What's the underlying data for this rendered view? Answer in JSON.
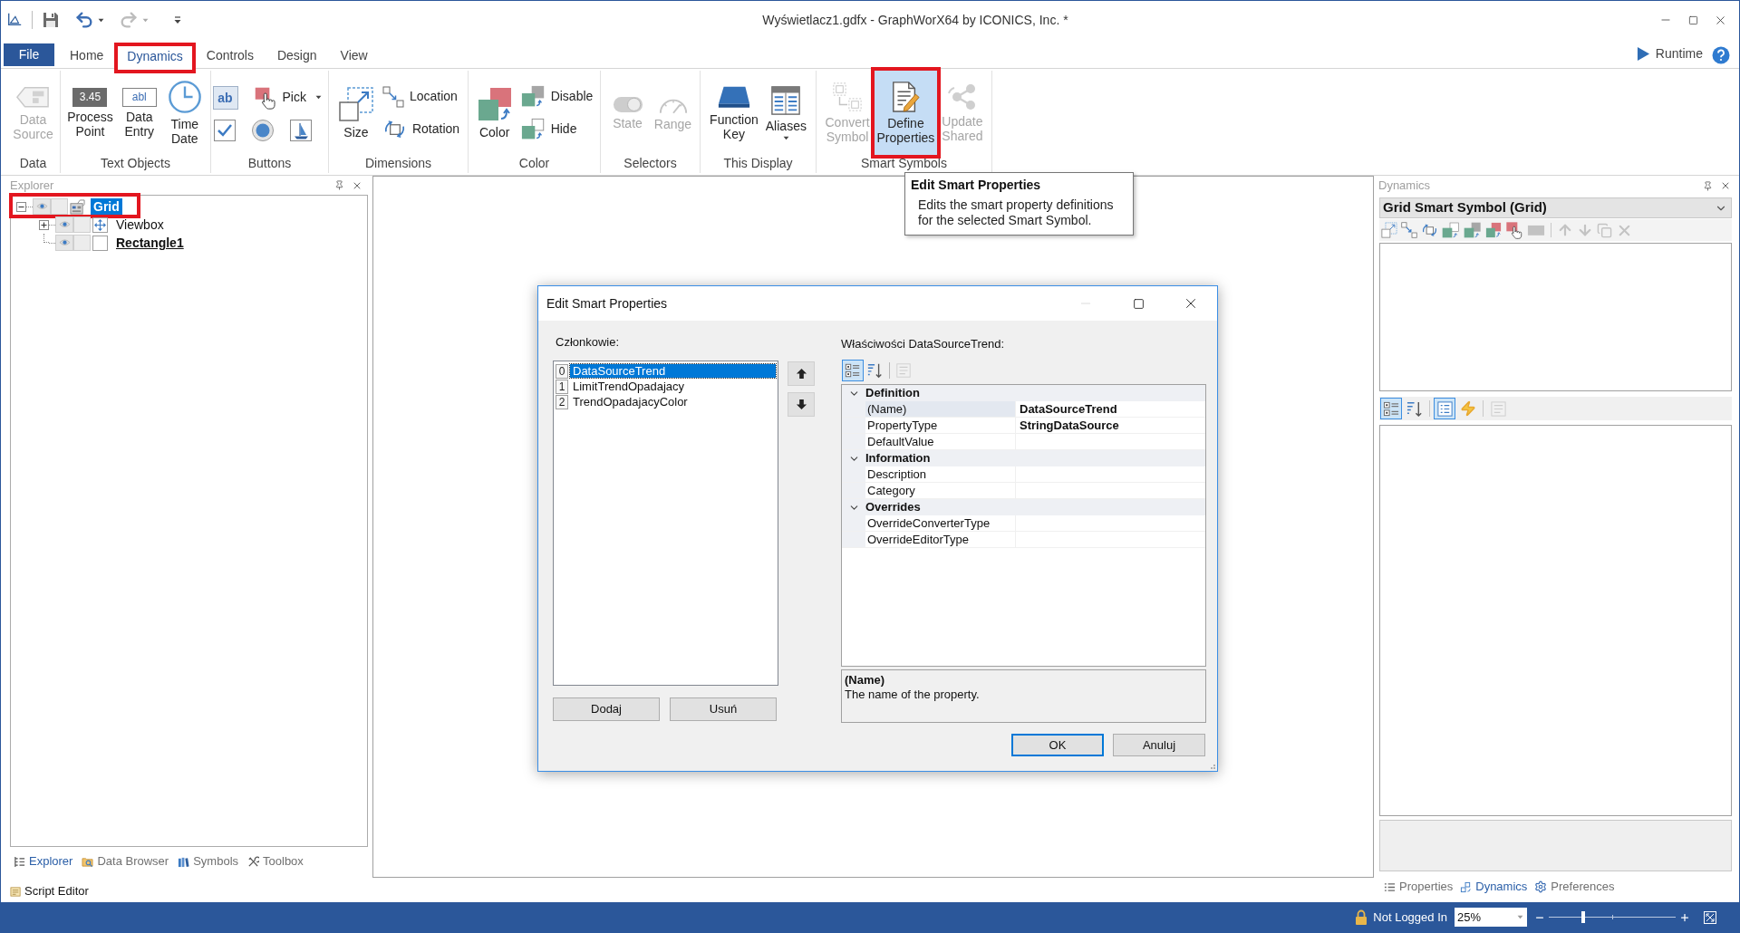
{
  "title_bar": {
    "quick_access": [
      {
        "disabled": false
      },
      {
        "disabled": false
      },
      {
        "disabled": true
      }
    ],
    "title": "Wyświetlacz1.gdfx - GraphWorX64 by ICONICS, Inc. *"
  },
  "ribbon": {
    "file_label": "File",
    "tabs": [
      {
        "label": "Home",
        "selected": false,
        "outlined": false
      },
      {
        "label": "Dynamics",
        "selected": true,
        "outlined": true
      },
      {
        "label": "Controls",
        "selected": false,
        "outlined": false
      },
      {
        "label": "Design",
        "selected": false,
        "outlined": false
      },
      {
        "label": "View",
        "selected": false,
        "outlined": false
      }
    ],
    "runtime_label": "Runtime",
    "groups": [
      {
        "label": "Data",
        "items": [
          {
            "kind": "large",
            "label": "Data Source",
            "disabled": true,
            "highlighted": false,
            "outlined": false,
            "dropdown": false
          }
        ]
      },
      {
        "label": "Text Objects",
        "items": [
          {
            "kind": "large",
            "label": "Process Point",
            "icon_text": "3.45",
            "disabled": false,
            "highlighted": false,
            "outlined": false,
            "dropdown": false
          },
          {
            "kind": "large",
            "label": "Data Entry",
            "icon_text": "abl",
            "disabled": false,
            "highlighted": false,
            "outlined": false,
            "dropdown": false
          },
          {
            "kind": "large",
            "label": "Time Date",
            "disabled": false,
            "highlighted": false,
            "outlined": false,
            "dropdown": false
          }
        ]
      },
      {
        "label": "Buttons",
        "items": [
          {
            "kind": "icon",
            "icon_text": "ab",
            "disabled": false,
            "highlighted": false,
            "outlined": false
          },
          {
            "kind": "small",
            "label": "Pick",
            "disabled": false,
            "highlighted": false,
            "outlined": false,
            "dropdown": true
          },
          {
            "kind": "icon",
            "disabled": false,
            "highlighted": false,
            "outlined": false
          },
          {
            "kind": "icon",
            "disabled": false,
            "highlighted": false,
            "outlined": false
          },
          {
            "kind": "icon",
            "disabled": false,
            "highlighted": false,
            "outlined": false
          }
        ]
      },
      {
        "label": "Dimensions",
        "items": [
          {
            "kind": "large",
            "label": "Size",
            "disabled": false,
            "highlighted": false,
            "outlined": false,
            "dropdown": false
          },
          {
            "kind": "small",
            "label": "Location",
            "disabled": false,
            "highlighted": false,
            "outlined": false,
            "dropdown": false
          },
          {
            "kind": "small",
            "label": "Rotation",
            "disabled": false,
            "highlighted": false,
            "outlined": false,
            "dropdown": false
          }
        ]
      },
      {
        "label": "Color",
        "items": [
          {
            "kind": "large",
            "label": "Color",
            "disabled": false,
            "highlighted": false,
            "outlined": false,
            "dropdown": false
          },
          {
            "kind": "small",
            "label": "Disable",
            "disabled": false,
            "highlighted": false,
            "outlined": false,
            "dropdown": false
          },
          {
            "kind": "small",
            "label": "Hide",
            "disabled": false,
            "highlighted": false,
            "outlined": false,
            "dropdown": false
          }
        ]
      },
      {
        "label": "Selectors",
        "items": [
          {
            "kind": "large",
            "label": "State",
            "disabled": true,
            "highlighted": false,
            "outlined": false,
            "dropdown": false
          },
          {
            "kind": "large",
            "label": "Range",
            "disabled": true,
            "highlighted": false,
            "outlined": false,
            "dropdown": false
          }
        ]
      },
      {
        "label": "This Display",
        "items": [
          {
            "kind": "large",
            "label": "Function Key",
            "disabled": false,
            "highlighted": false,
            "outlined": false,
            "dropdown": false
          },
          {
            "kind": "large",
            "label": "Aliases",
            "disabled": false,
            "highlighted": false,
            "outlined": false,
            "dropdown": true
          }
        ]
      },
      {
        "label": "Smart Symbols",
        "items": [
          {
            "kind": "large",
            "label": "Convert Symbol",
            "disabled": true,
            "highlighted": false,
            "outlined": false,
            "dropdown": false
          },
          {
            "kind": "large",
            "label": "Define Properties",
            "disabled": false,
            "highlighted": true,
            "outlined": true,
            "dropdown": false
          },
          {
            "kind": "large",
            "label": "Update Shared",
            "disabled": true,
            "highlighted": false,
            "outlined": false,
            "dropdown": false
          }
        ]
      }
    ]
  },
  "tooltip": {
    "title": "Edit Smart Properties",
    "text": "Edits the smart property definitions for the selected Smart Symbol."
  },
  "explorer": {
    "title": "Explorer",
    "tree": [
      {
        "kind": "symbol",
        "label": "Grid",
        "selected": true,
        "current": false,
        "outlined": true,
        "expanded": true,
        "children": [
          {
            "kind": "viewbox",
            "label": "Viewbox",
            "selected": false,
            "current": false,
            "outlined": false,
            "expanded": false
          },
          {
            "kind": "rectangle",
            "label": "Rectangle1",
            "selected": false,
            "current": true,
            "outlined": false
          }
        ]
      }
    ],
    "tabs": [
      {
        "label": "Explorer",
        "selected": true
      },
      {
        "label": "Data Browser",
        "selected": false
      },
      {
        "label": "Symbols",
        "selected": false
      },
      {
        "label": "Toolbox",
        "selected": false
      }
    ],
    "script_editor": "Script Editor"
  },
  "dynamics_panel": {
    "title": "Dynamics",
    "selector": "Grid Smart Symbol (Grid)",
    "toolbar": [
      {
        "disabled": false
      },
      {
        "disabled": false
      },
      {
        "disabled": false
      },
      {
        "disabled": false
      },
      {
        "disabled": false
      },
      {
        "disabled": false
      },
      {
        "disabled": false
      },
      {
        "disabled": true
      },
      {
        "disabled": true
      },
      {
        "disabled": true
      },
      {
        "disabled": true
      },
      {
        "disabled": true
      }
    ],
    "view_toolbar": [
      {
        "selected": true,
        "disabled": false
      },
      {
        "selected": false,
        "disabled": false
      },
      {
        "selected": true,
        "disabled": false
      },
      {
        "selected": false,
        "disabled": false
      },
      {
        "selected": false,
        "disabled": true
      }
    ],
    "tabs": [
      {
        "label": "Properties",
        "selected": false
      },
      {
        "label": "Dynamics",
        "selected": true
      },
      {
        "label": "Preferences",
        "selected": false
      }
    ]
  },
  "dialog": {
    "title": "Edit Smart Properties",
    "window_buttons": [
      {
        "disabled": true
      },
      {
        "disabled": false
      },
      {
        "disabled": false
      }
    ],
    "members_label": "Członkowie:",
    "members": [
      {
        "index": "0",
        "name": "DataSourceTrend",
        "selected": true
      },
      {
        "index": "1",
        "name": "LimitTrendOpadajacy",
        "selected": false
      },
      {
        "index": "2",
        "name": "TrendOpadajacyColor",
        "selected": false
      }
    ],
    "properties_label": "Właściwości DataSourceTrend:",
    "grid_toolbar": [
      {
        "selected": true,
        "disabled": false
      },
      {
        "selected": false,
        "disabled": false
      },
      {
        "selected": false,
        "disabled": true
      }
    ],
    "categories": [
      {
        "name": "Definition",
        "expanded": true,
        "properties": [
          {
            "name": "(Name)",
            "value": "DataSourceTrend",
            "selected": true
          },
          {
            "name": "PropertyType",
            "value": "StringDataSource",
            "selected": false
          },
          {
            "name": "DefaultValue",
            "selected": false
          }
        ]
      },
      {
        "name": "Information",
        "expanded": true,
        "properties": [
          {
            "name": "Description",
            "selected": false
          },
          {
            "name": "Category",
            "selected": false
          }
        ]
      },
      {
        "name": "Overrides",
        "expanded": true,
        "properties": [
          {
            "name": "OverrideConverterType",
            "selected": false
          },
          {
            "name": "OverrideEditorType",
            "selected": false
          }
        ]
      }
    ],
    "description": {
      "title": "(Name)",
      "text": "The name of the property."
    },
    "add_label": "Dodaj",
    "remove_label": "Usuń",
    "ok_label": "OK",
    "cancel_label": "Anuluj"
  },
  "status_bar": {
    "login": "Not Logged In",
    "zoom": "25%",
    "zoom_slider": {
      "level": 0.27
    }
  }
}
